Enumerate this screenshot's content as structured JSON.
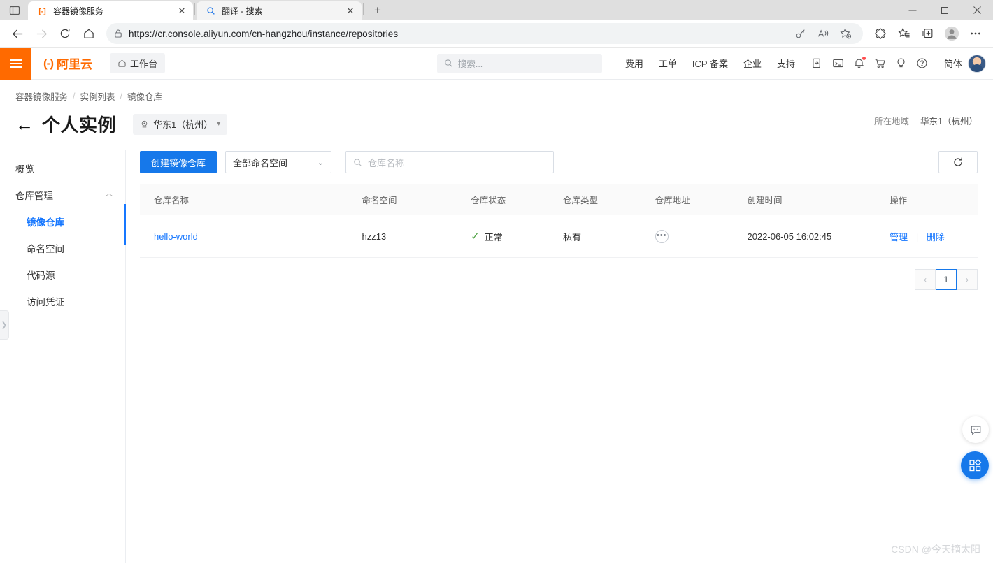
{
  "browser": {
    "tabs": [
      {
        "title": "容器镜像服务",
        "favicon": "aliyun-cr-icon",
        "active": true
      },
      {
        "title": "翻译 - 搜索",
        "favicon": "search-icon",
        "active": false
      }
    ],
    "new_tab_label": "+",
    "window_controls": {
      "minimize": "—",
      "maximize": "▢",
      "close": "✕"
    },
    "url": "https://cr.console.aliyun.com/cn-hangzhou/instance/repositories",
    "url_host": "cr.console.aliyun.com",
    "url_path": "/cn-hangzhou/instance/repositories",
    "url_scheme": "https://"
  },
  "header": {
    "logo_text": "阿里云",
    "logo_mark": "(-)",
    "workbench": "工作台",
    "search_placeholder": "搜索...",
    "nav": [
      "费用",
      "工单",
      "ICP 备案",
      "企业",
      "支持"
    ],
    "language": "简体"
  },
  "breadcrumb": [
    "容器镜像服务",
    "实例列表",
    "镜像仓库"
  ],
  "page": {
    "title": "个人实例",
    "region_selected": "华东1（杭州）",
    "region_label": "所在地域",
    "region_value": "华东1（杭州）"
  },
  "sidebar": {
    "items": [
      {
        "label": "概览",
        "type": "item"
      },
      {
        "label": "仓库管理",
        "type": "group"
      },
      {
        "label": "镜像仓库",
        "type": "sub",
        "active": true
      },
      {
        "label": "命名空间",
        "type": "sub",
        "active": false
      },
      {
        "label": "代码源",
        "type": "sub",
        "active": false
      },
      {
        "label": "访问凭证",
        "type": "sub",
        "active": false
      }
    ]
  },
  "toolbar": {
    "create_button": "创建镜像仓库",
    "namespace_select": "全部命名空间",
    "search_placeholder": "仓库名称",
    "refresh_icon": "refresh-icon"
  },
  "table": {
    "columns": [
      "仓库名称",
      "命名空间",
      "仓库状态",
      "仓库类型",
      "仓库地址",
      "创建时间",
      "操作"
    ],
    "rows": [
      {
        "name": "hello-world",
        "namespace": "hzz13",
        "status": "正常",
        "type": "私有",
        "address": "•••",
        "created_at": "2022-06-05 16:02:45",
        "actions": [
          "管理",
          "删除"
        ]
      }
    ]
  },
  "pagination": {
    "prev": "‹",
    "current": "1",
    "next": "›"
  },
  "watermark": "CSDN @今天摘太阳",
  "colors": {
    "brand_orange": "#ff6a00",
    "primary_blue": "#1678ea",
    "link_blue": "#1677ff",
    "status_green": "#52a447"
  }
}
